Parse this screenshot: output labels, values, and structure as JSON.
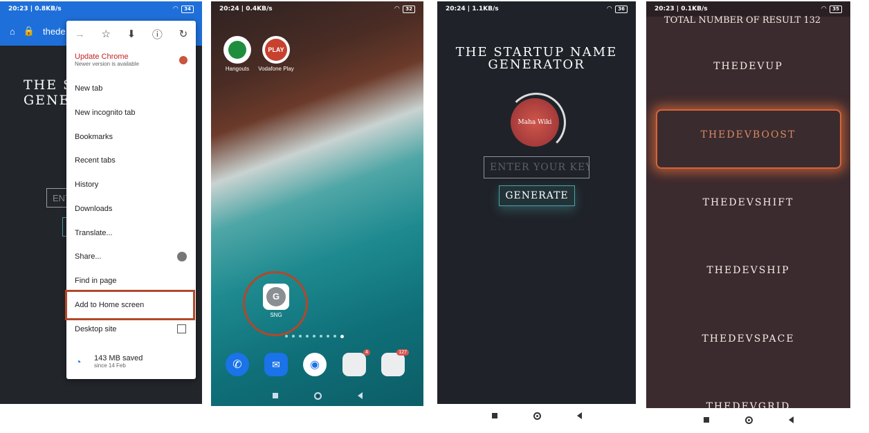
{
  "panel1": {
    "status": {
      "time": "20:23 | 0.8KB/s",
      "battery": "34"
    },
    "url_fragment": "thede",
    "page_title": "THE STARTUP NAME GENERATOR",
    "input_placeholder": "ENTER YOUR KEY W",
    "menu": {
      "update": {
        "label": "Update Chrome",
        "sublabel": "Newer version is available"
      },
      "items": [
        "New tab",
        "New incognito tab",
        "Bookmarks",
        "Recent tabs",
        "History",
        "Downloads",
        "Translate...",
        "Share...",
        "Find in page",
        "Add to Home screen",
        "Desktop site"
      ],
      "saved": {
        "label": "143 MB saved",
        "sublabel": "since 14 Feb"
      }
    },
    "colors": {
      "chrome_blue": "#1e6fd9",
      "highlight": "#b3472a"
    }
  },
  "panel2": {
    "status": {
      "time": "20:24 | 0.4KB/s",
      "battery": "32"
    },
    "apps": [
      {
        "label": "Hangouts",
        "icon": "hangouts-icon"
      },
      {
        "label": "Vodafone Play",
        "icon": "vodafone-play-icon",
        "glyph": "PLAY"
      }
    ],
    "shortcut": {
      "label": "SNG",
      "letter": "G"
    },
    "dock_badges": [
      "4",
      "127"
    ]
  },
  "panel3": {
    "status": {
      "time": "20:24 | 1.1KB/s",
      "battery": "36"
    },
    "title_line1": "THE STARTUP NAME",
    "title_line2": "GENERATOR",
    "logo_text": "Maha Wiki",
    "input_placeholder": "ENTER YOUR KEY W",
    "generate_label": "GENERATE"
  },
  "panel4": {
    "status": {
      "time": "20:23 | 0.1KB/s",
      "battery": "35"
    },
    "header": "TOTAL NUMBER OF RESULT 132",
    "results": [
      "THEDEVUP",
      "THEDEVBOOST",
      "THEDEVSHIFT",
      "THEDEVSHIP",
      "THEDEVSPACE",
      "THEDEVGRID"
    ],
    "selected_result": "THEDEVBOOST"
  }
}
